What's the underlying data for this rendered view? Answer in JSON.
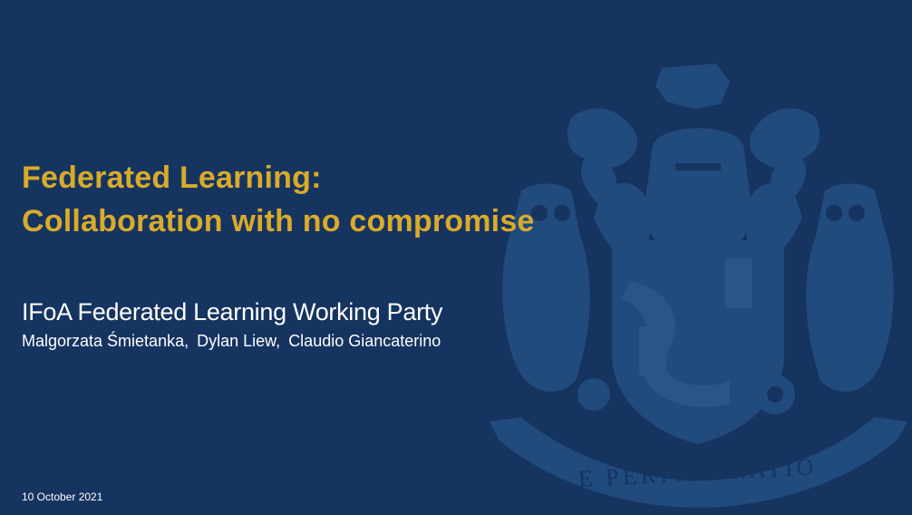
{
  "slide": {
    "title_line1": "Federated Learning:",
    "title_line2": "Collaboration with no compromise",
    "subtitle": "IFoA Federated Learning Working Party",
    "authors": [
      "Malgorzata Śmietanka,",
      "Dylan Liew,",
      "Claudio Giancaterino"
    ],
    "date": "10 October 2021",
    "crest_motto": "E PERITIA RATIO"
  },
  "colors": {
    "background": "#163460",
    "title": "#d9ab2a",
    "text": "#ffffff",
    "crest": "#214a7d"
  }
}
